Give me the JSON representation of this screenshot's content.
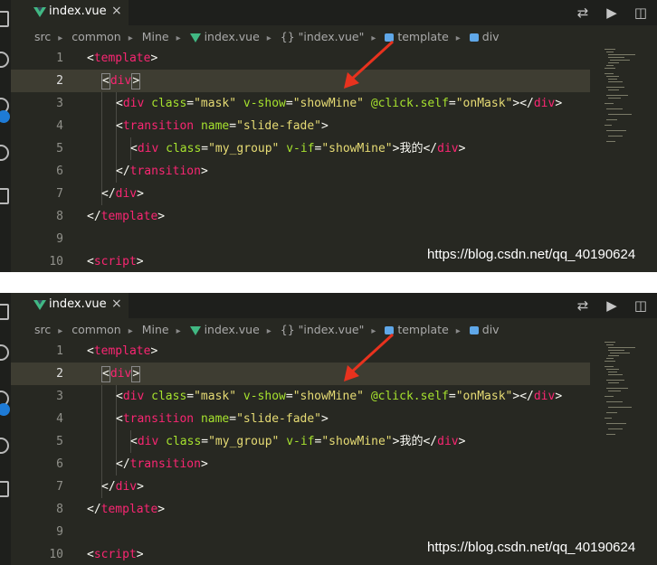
{
  "tab": {
    "label": "index.vue",
    "close": "×",
    "icon": "vue-icon"
  },
  "toolbar": {
    "compare": "⇄",
    "run": "▶",
    "split": "◫"
  },
  "breadcrumb": {
    "items": [
      "src",
      "common",
      "Mine",
      "index.vue",
      "{} \"index.vue\"",
      "template",
      "div"
    ],
    "separator": "▸"
  },
  "code_lines": [
    {
      "n": "1"
    },
    {
      "n": "2"
    },
    {
      "n": "3"
    },
    {
      "n": "4"
    },
    {
      "n": "5"
    },
    {
      "n": "6"
    },
    {
      "n": "7"
    },
    {
      "n": "8"
    },
    {
      "n": "9"
    },
    {
      "n": "10"
    }
  ],
  "tokens": {
    "lt": "<",
    "gt": ">",
    "close_lt": "</",
    "eq": "=",
    "template": "template",
    "div": "div",
    "script": "script",
    "transition": "transition",
    "class": "class",
    "v_show": "v-show",
    "click_self": "@click.self",
    "name": "name",
    "v_if": "v-if",
    "mask": "\"mask\"",
    "showMine": "\"showMine\"",
    "onMask": "\"onMask\"",
    "slide_fade": "\"slide-fade\"",
    "my_group": "\"my_group\"",
    "text_wode": "我的"
  },
  "watermark": "https://blog.csdn.net/qq_40190624",
  "colors": {
    "background": "#272822",
    "tag": "#f92672",
    "attr": "#a6e22e",
    "string": "#e6db74",
    "arrow": "#e8321e"
  }
}
